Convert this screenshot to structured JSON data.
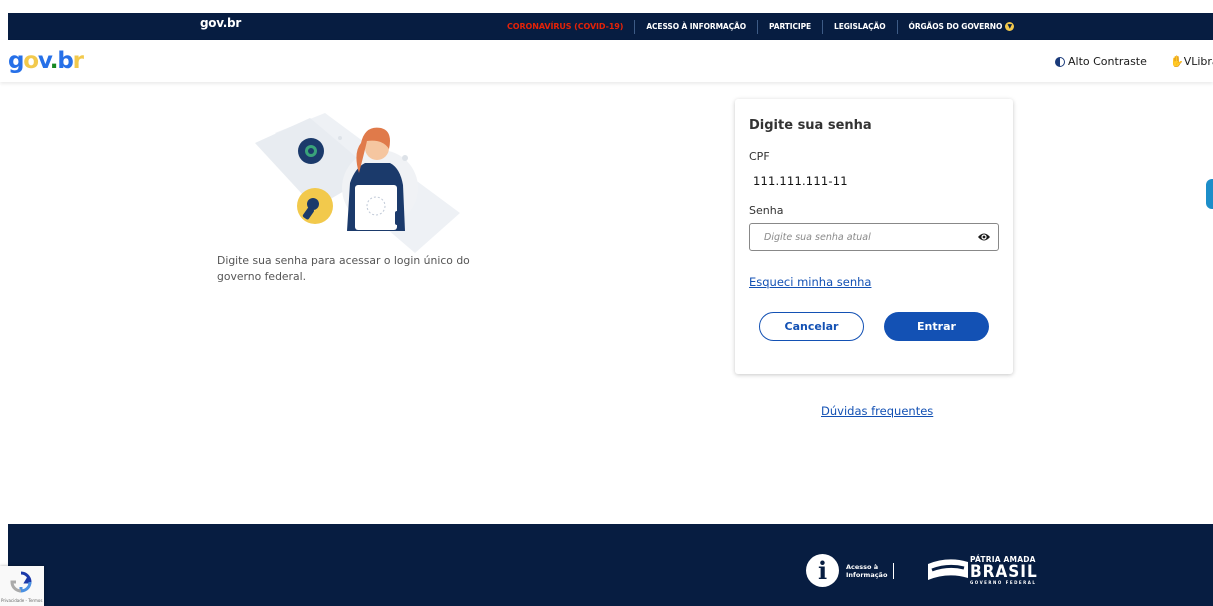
{
  "topbar": {
    "logo": "gov.br",
    "links": [
      {
        "label": "CORONAVÍRUS (COVID-19)",
        "highlight": true
      },
      {
        "label": "ACESSO À INFORMAÇÃO"
      },
      {
        "label": "PARTICIPE"
      },
      {
        "label": "LEGISLAÇÃO"
      },
      {
        "label": "ÓRGÃOS DO GOVERNO"
      }
    ],
    "dropdown_icon": "chevron-down-icon"
  },
  "header": {
    "brand": "gov.br",
    "contrast_label": "Alto Contraste",
    "contrast_icon": "contrast-icon",
    "vlibras_label": "VLibras",
    "vlibras_icon": "hand-icon"
  },
  "intro": {
    "text": "Digite sua senha para acessar o login único do governo federal.",
    "illustration": "woman-with-key-illustration"
  },
  "login": {
    "title": "Digite sua senha",
    "cpf_label": "CPF",
    "cpf_value": "111.111.111-11",
    "password_label": "Senha",
    "password_placeholder": "Digite sua senha atual",
    "password_value": "",
    "show_password_icon": "eye-icon",
    "forgot_link": "Esqueci minha senha",
    "cancel_label": "Cancelar",
    "enter_label": "Entrar"
  },
  "faq_link": "Dúvidas frequentes",
  "footer": {
    "access_info_line1": "Acesso à",
    "access_info_line2": "Informação",
    "patria_line1": "PÁTRIA AMADA",
    "patria_line2": "BRASIL",
    "patria_line3": "GOVERNO FEDERAL"
  },
  "recaptcha": {
    "text": "Privacidade - Termos"
  },
  "colors": {
    "navy": "#071d41",
    "primary_blue": "#1351b4",
    "covid_red": "#e52207",
    "yellow": "#f2c94c"
  }
}
